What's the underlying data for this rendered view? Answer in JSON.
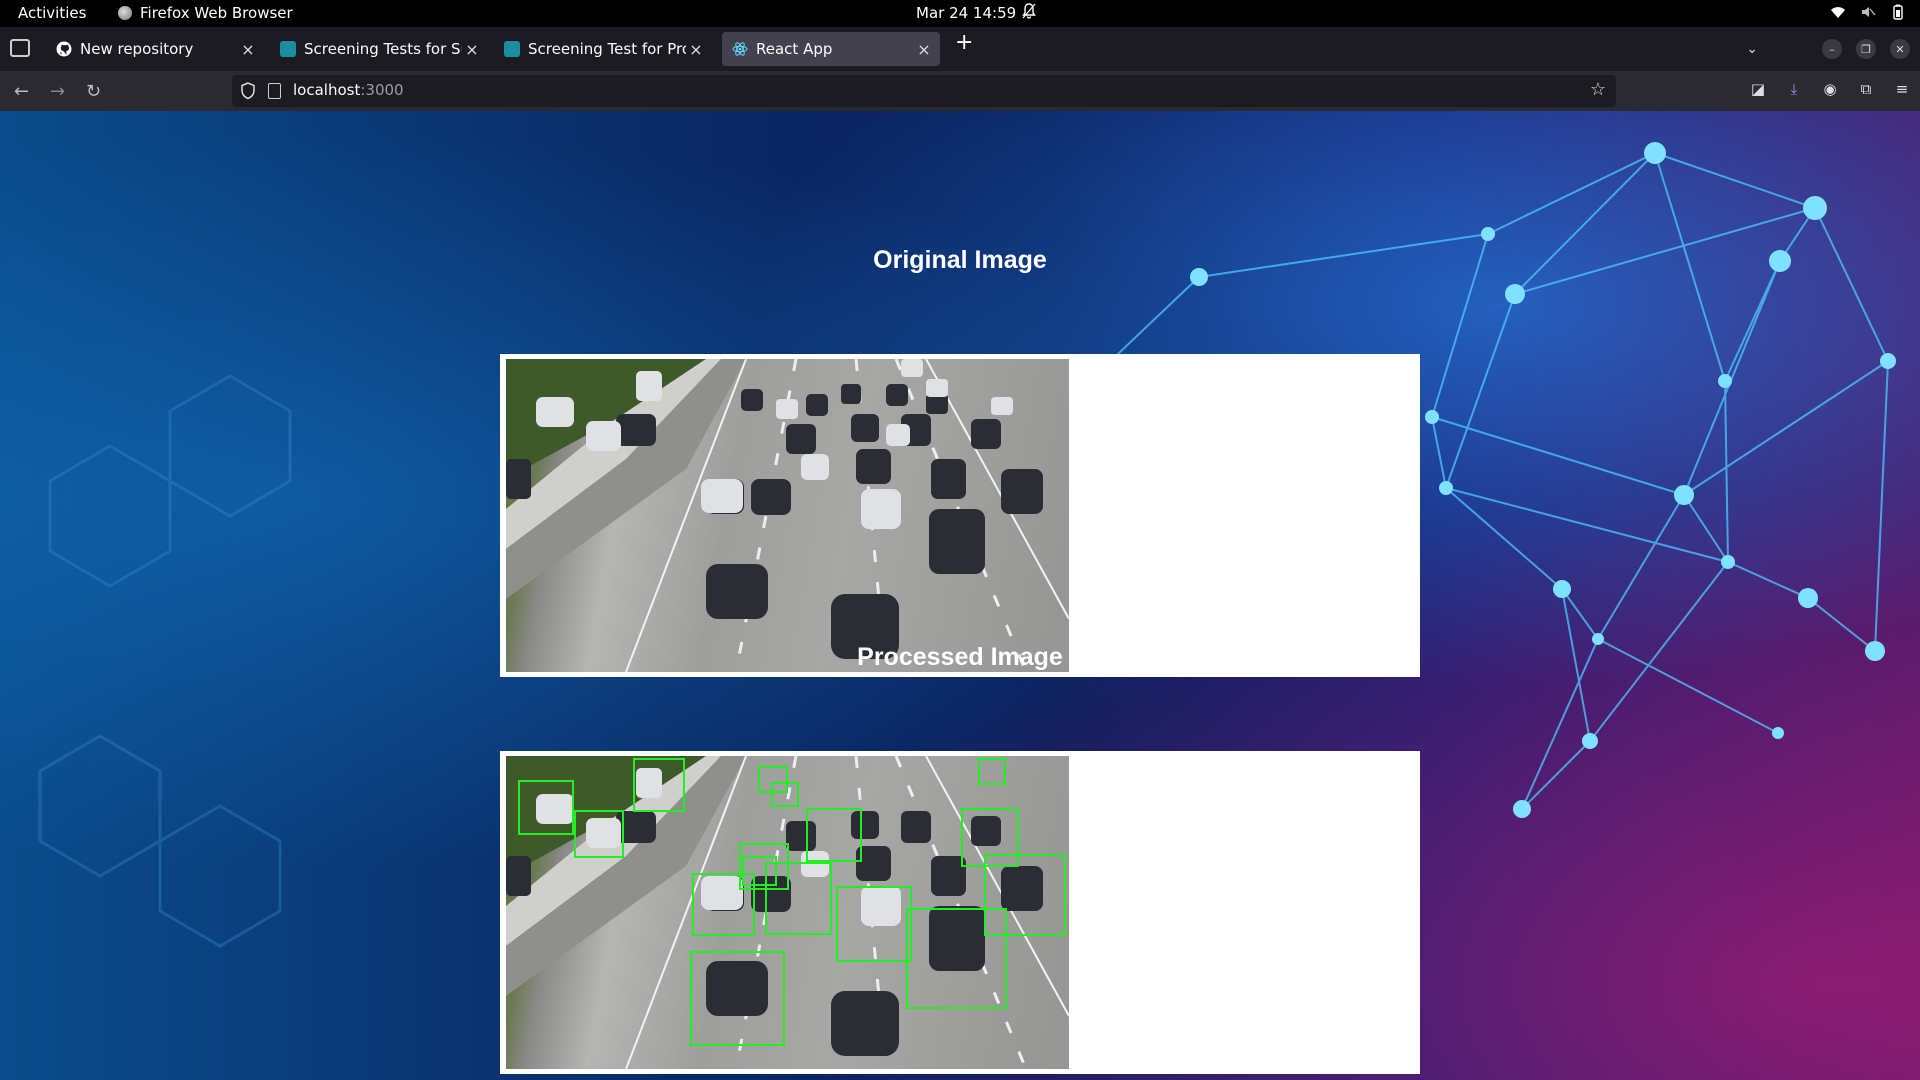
{
  "system_bar": {
    "activities": "Activities",
    "app_name": "Firefox Web Browser",
    "clock": "Mar 24  14:59"
  },
  "tabs": [
    {
      "title": "New repository",
      "icon": "github-icon"
    },
    {
      "title": "Screening Tests for Summ",
      "icon": "site-icon"
    },
    {
      "title": "Screening Test for Projec",
      "icon": "site-icon"
    },
    {
      "title": "React App",
      "icon": "react-icon",
      "active": true
    }
  ],
  "address_bar": {
    "host": "localhost",
    "port": ":3000"
  },
  "page": {
    "original_heading": "Original Image",
    "processed_heading": "Processed Image"
  },
  "colors": {
    "detection_box": "#22ee22",
    "frame": "#ffffff",
    "heading_text": "#ffffff"
  },
  "detections": {
    "count": 18
  }
}
